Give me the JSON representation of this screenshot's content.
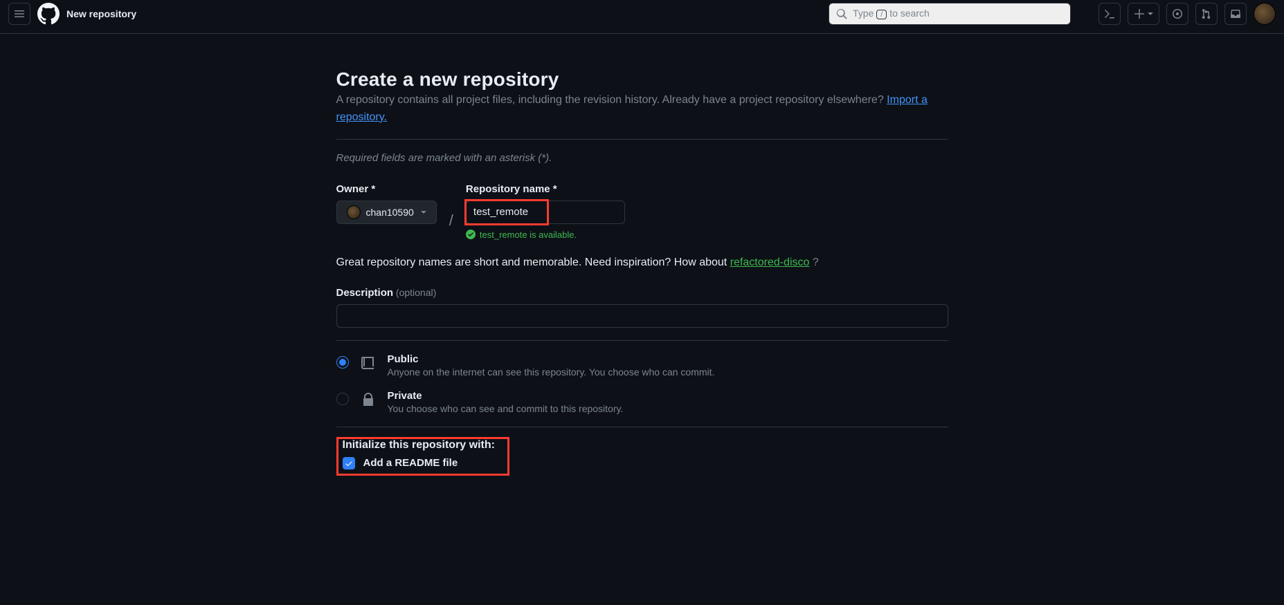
{
  "header": {
    "context": "New repository",
    "search_prefix": "Type ",
    "search_key": "/",
    "search_suffix": " to search"
  },
  "page": {
    "title": "Create a new repository",
    "subtitle_main": "A repository contains all project files, including the revision history. Already have a project repository elsewhere? ",
    "import_link": "Import a repository.",
    "required_note": "Required fields are marked with an asterisk (*).",
    "owner_label": "Owner *",
    "owner_value": "chan10590",
    "repo_label": "Repository name *",
    "repo_value": "test_remote",
    "avail_text": "test_remote is available.",
    "hint_prefix": "Great repository names are short and memorable. Need inspiration? How about ",
    "hint_sugg": "refactored-disco",
    "hint_suffix": " ?",
    "desc_label": "Description",
    "desc_opt": "(optional)",
    "vis_public_title": "Public",
    "vis_public_desc": "Anyone on the internet can see this repository. You choose who can commit.",
    "vis_private_title": "Private",
    "vis_private_desc": "You choose who can see and commit to this repository.",
    "init_title": "Initialize this repository with:",
    "readme_label": "Add a README file"
  }
}
